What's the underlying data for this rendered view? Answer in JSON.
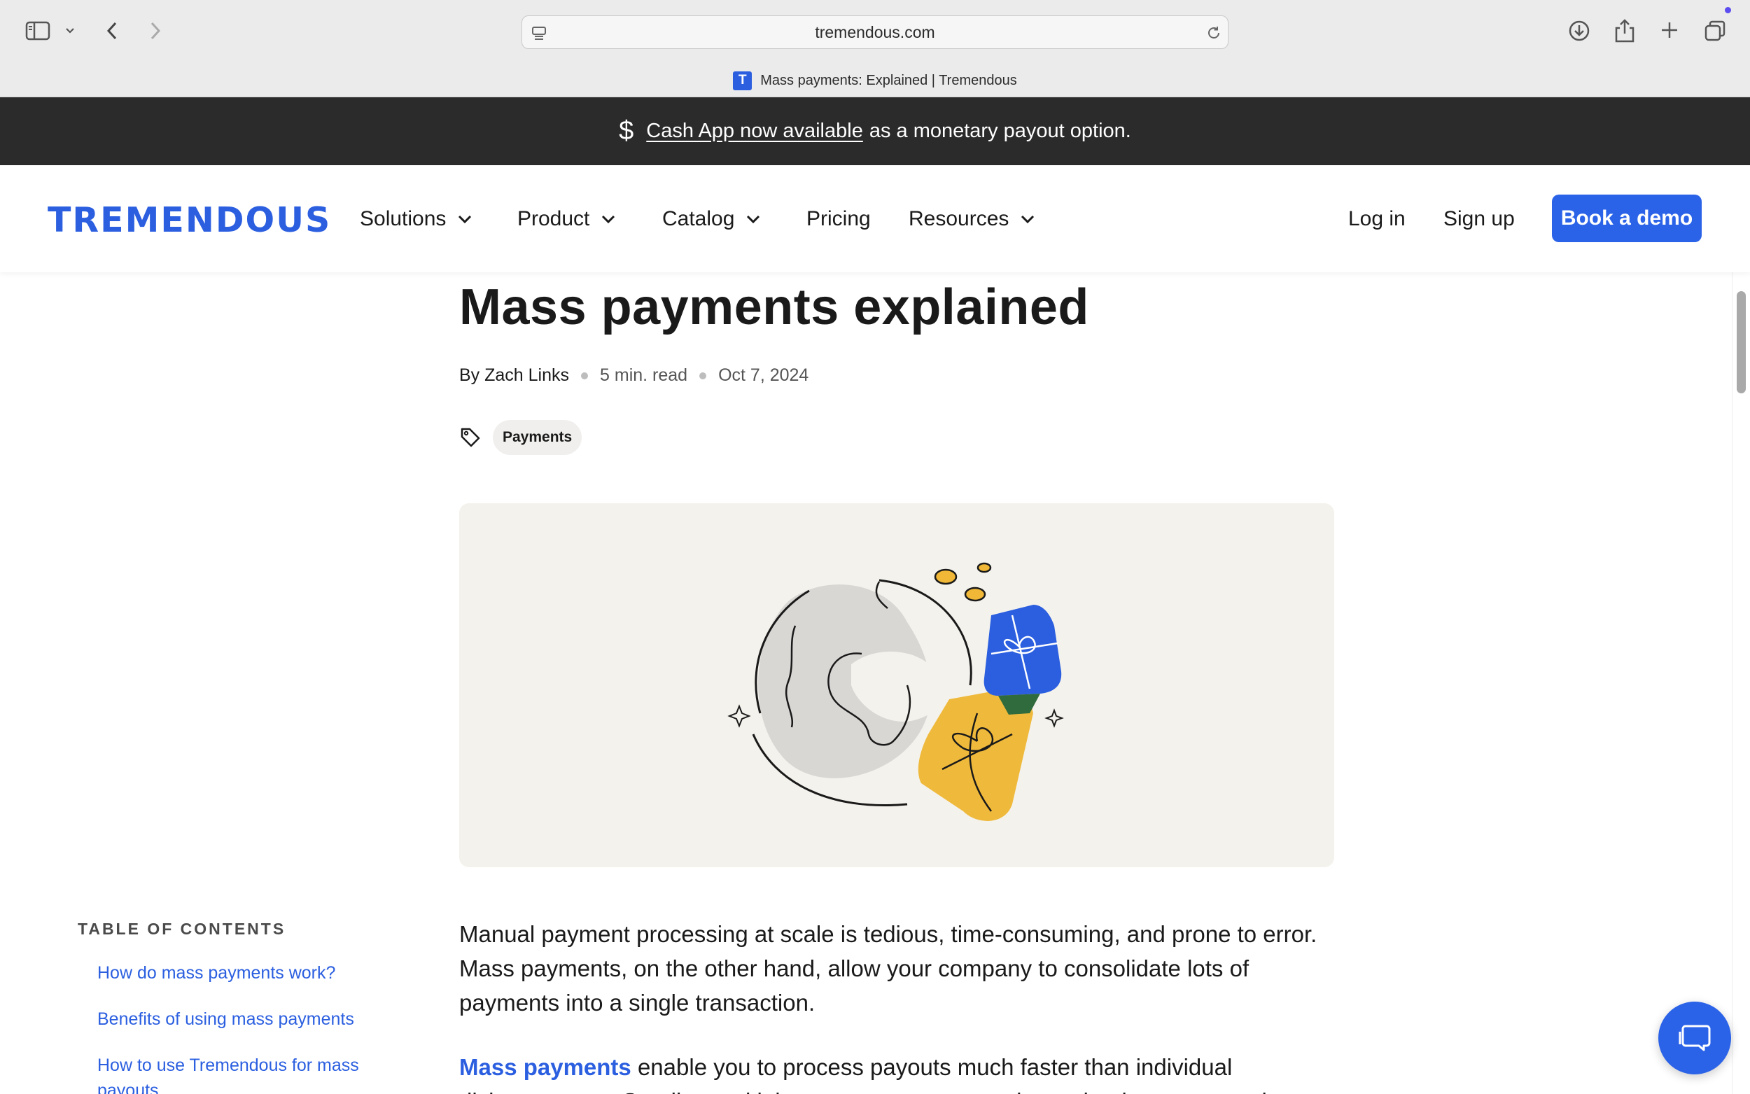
{
  "browser": {
    "url": "tremendous.com",
    "tab_title": "Mass payments: Explained | Tremendous",
    "favicon_letter": "T",
    "accent_color": "#2b5fe0"
  },
  "banner": {
    "icon": "dollar-icon",
    "icon_glyph": "$",
    "link_text": "Cash App now available",
    "rest_text": "as a monetary payout option."
  },
  "nav": {
    "logo": "TREMENDOUS",
    "items": [
      {
        "label": "Solutions",
        "has_dropdown": true
      },
      {
        "label": "Product",
        "has_dropdown": true
      },
      {
        "label": "Catalog",
        "has_dropdown": true
      },
      {
        "label": "Pricing",
        "has_dropdown": false
      },
      {
        "label": "Resources",
        "has_dropdown": true
      }
    ],
    "login": "Log in",
    "signup": "Sign up",
    "demo": "Book a demo",
    "brand_color": "#2b63e8"
  },
  "article": {
    "title": "Mass payments explained",
    "author": "By Zach Links",
    "read_time": "5 min. read",
    "date": "Oct 7, 2024",
    "tag": "Payments",
    "hero_alt": "globe-with-gift-cards-illustration",
    "paragraph1": "Manual payment processing at scale is tedious, time-consuming, and prone to error. Mass payments, on the other hand, allow your company to consolidate lots of payments into a single transaction.",
    "paragraph2_link": "Mass payments",
    "paragraph2_rest": " enable you to process payouts much faster than individual disbursements. Sending multiple payments at once reduces the time spent and"
  },
  "toc": {
    "heading": "TABLE OF CONTENTS",
    "items": [
      "How do mass payments work?",
      "Benefits of using mass payments",
      "How to use Tremendous for mass payouts"
    ]
  }
}
